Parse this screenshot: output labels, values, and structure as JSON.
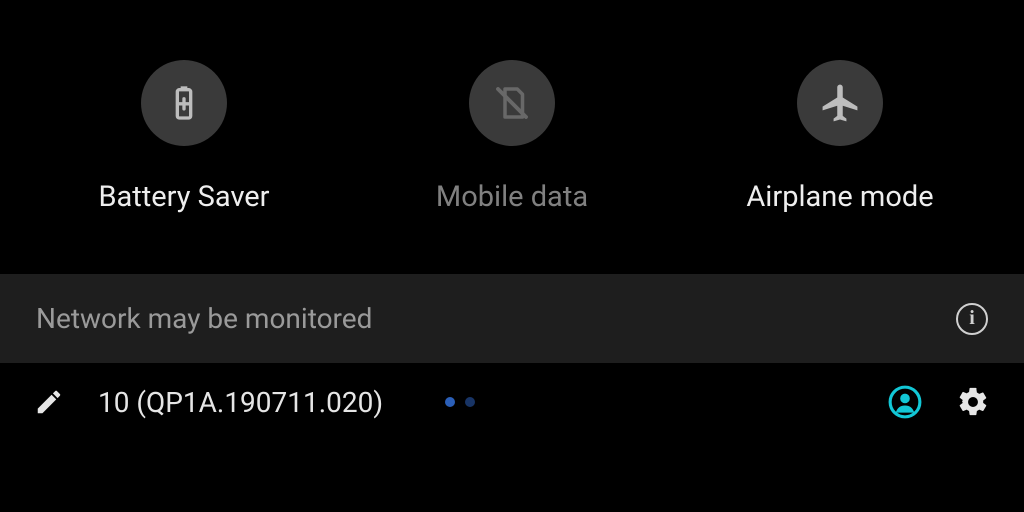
{
  "tiles": [
    {
      "id": "battery-saver",
      "label": "Battery Saver",
      "icon": "battery-plus-icon",
      "state": "enabled"
    },
    {
      "id": "mobile-data",
      "label": "Mobile data",
      "icon": "sim-off-icon",
      "state": "disabled"
    },
    {
      "id": "airplane-mode",
      "label": "Airplane mode",
      "icon": "airplane-icon",
      "state": "enabled"
    }
  ],
  "warning": {
    "text": "Network may be monitored"
  },
  "footer": {
    "version": "10 (QP1A.190711.020)",
    "page_count": 2,
    "page_current": 1
  },
  "colors": {
    "accent": "#12c7d6",
    "tile_circle": "#3a3a3a",
    "warning_bg": "#1e1e1e"
  }
}
